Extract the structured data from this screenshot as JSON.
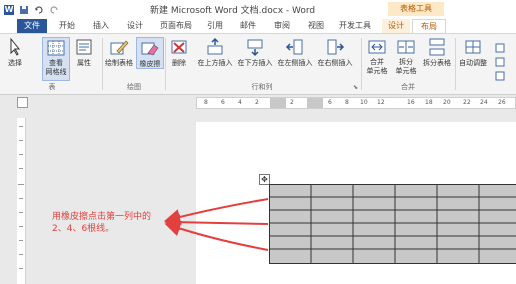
{
  "window": {
    "title": "新建 Microsoft Word 文档.docx - Word",
    "context_header": "表格工具"
  },
  "tabs": [
    {
      "label": "文件"
    },
    {
      "label": "开始"
    },
    {
      "label": "插入"
    },
    {
      "label": "设计"
    },
    {
      "label": "页面布局"
    },
    {
      "label": "引用"
    },
    {
      "label": "邮件"
    },
    {
      "label": "审阅"
    },
    {
      "label": "视图"
    },
    {
      "label": "开发工具"
    },
    {
      "label": "设计"
    },
    {
      "label": "布局"
    }
  ],
  "ribbon": {
    "buttons": {
      "select": "选择",
      "view_gridlines": "查看\n网格线",
      "properties": "属性",
      "draw_table": "绘制表格",
      "eraser": "橡皮擦",
      "delete": "删除",
      "insert_above": "在上方插入",
      "insert_below": "在下方插入",
      "insert_left": "在左侧插入",
      "insert_right": "在右侧插入",
      "merge_cells": "合并\n单元格",
      "split_cells": "拆分\n单元格",
      "split_table": "拆分表格",
      "autofit": "自动调整"
    },
    "groups": {
      "table": "表",
      "draw": "绘图",
      "rows_cols": "行和列",
      "merge": "合并"
    }
  },
  "ruler": {
    "numbers": [
      "8",
      "6",
      "4",
      "2",
      "2",
      "6",
      "8",
      "10",
      "12",
      "16",
      "18",
      "20",
      "22",
      "24",
      "26"
    ]
  },
  "annotation": {
    "line1": "用橡皮擦点击第一列中的",
    "line2": "2、4、6根线。"
  },
  "colors": {
    "word_blue": "#2b579a",
    "context_orange": "#b45b00",
    "annotation_red": "#e2403e",
    "cell_gray": "#c8c8c8"
  }
}
